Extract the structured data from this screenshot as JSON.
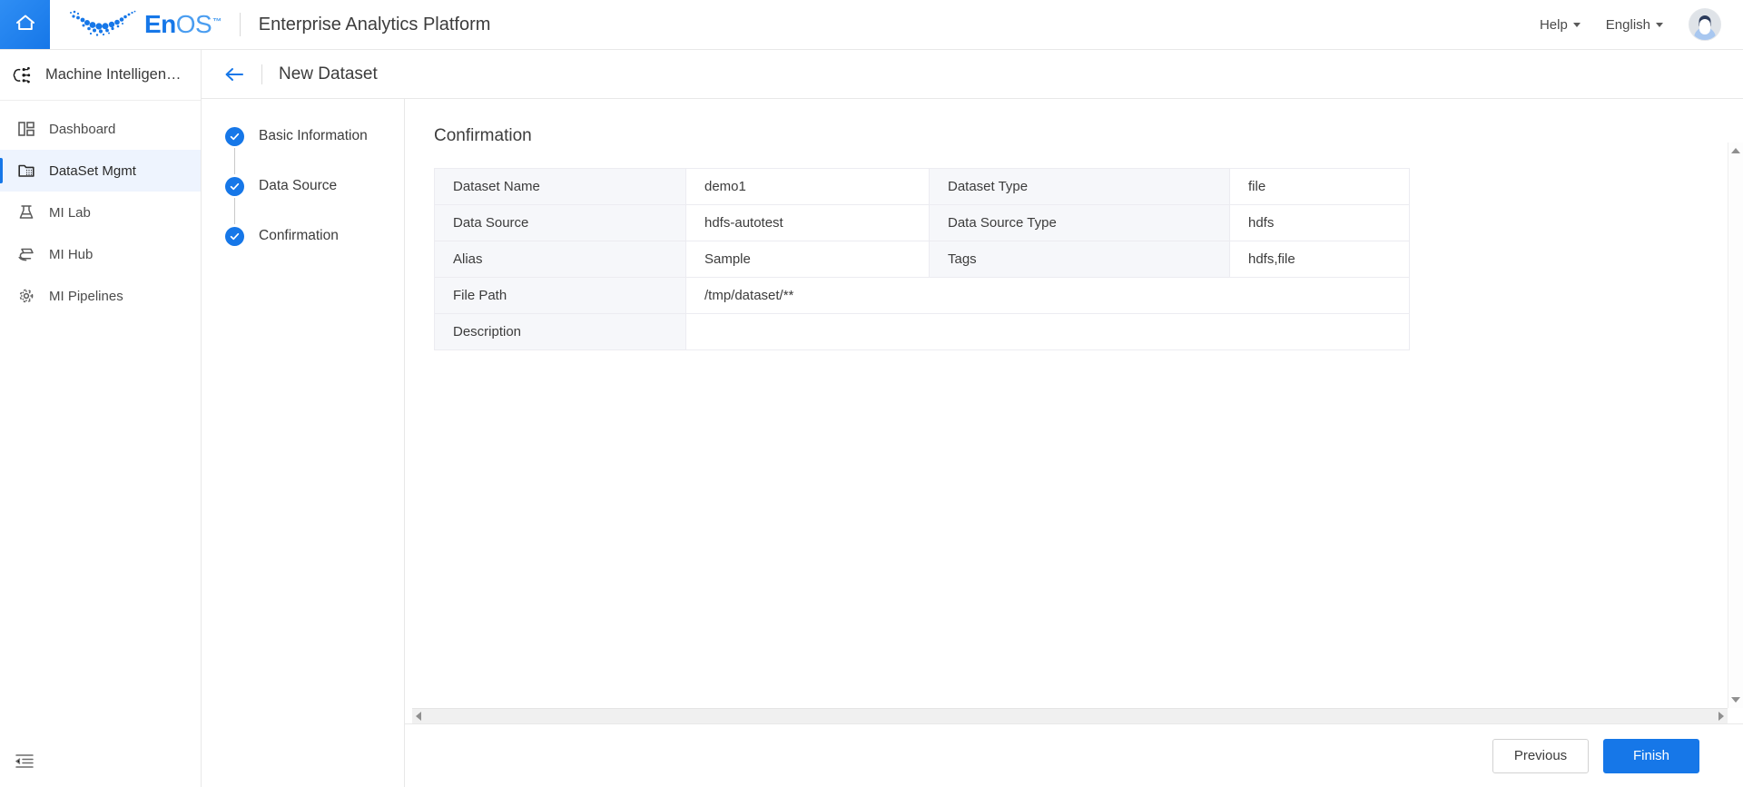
{
  "header": {
    "home_icon": "home-icon",
    "brand": "EnOS",
    "brand_tm": "™",
    "app_title": "Enterprise Analytics Platform",
    "help_label": "Help",
    "language_label": "English",
    "avatar_icon": "user-avatar"
  },
  "sidebar": {
    "product_name": "Machine Intelligen…",
    "product_icon": "brain-network-icon",
    "items": [
      {
        "label": "Dashboard",
        "icon": "dashboard-icon",
        "active": false
      },
      {
        "label": "DataSet Mgmt",
        "icon": "folder-data-icon",
        "active": true
      },
      {
        "label": "MI Lab",
        "icon": "flask-icon",
        "active": false
      },
      {
        "label": "MI Hub",
        "icon": "hub-icon",
        "active": false
      },
      {
        "label": "MI Pipelines",
        "icon": "pipeline-gear-icon",
        "active": false
      }
    ],
    "collapse_icon": "collapse-sidebar-icon"
  },
  "page": {
    "back_icon": "back-arrow-icon",
    "title": "New Dataset"
  },
  "steps": [
    {
      "label": "Basic Information",
      "state": "done"
    },
    {
      "label": "Data Source",
      "state": "done"
    },
    {
      "label": "Confirmation",
      "state": "done"
    }
  ],
  "main": {
    "section_title": "Confirmation",
    "table": {
      "rows": [
        {
          "label": "Dataset Name",
          "value": "demo1",
          "label2": "Dataset Type",
          "value2": "file"
        },
        {
          "label": "Data Source",
          "value": "hdfs-autotest",
          "label2": "Data Source Type",
          "value2": "hdfs"
        },
        {
          "label": "Alias",
          "value": "Sample",
          "label2": "Tags",
          "value2": "hdfs,file"
        },
        {
          "label": "File Path",
          "value": "/tmp/dataset/**",
          "label2": "",
          "value2": ""
        },
        {
          "label": "Description",
          "value": "",
          "label2": "",
          "value2": ""
        }
      ]
    },
    "vertical_scrollbar": "vertical-scrollbar",
    "horizontal_scrollbar": "horizontal-scrollbar"
  },
  "footer": {
    "previous_label": "Previous",
    "finish_label": "Finish"
  },
  "colors": {
    "accent": "#1677e8",
    "label_cell_bg": "#f6f7fa",
    "active_nav_bg": "#eef4fe",
    "border": "#ececf1"
  }
}
